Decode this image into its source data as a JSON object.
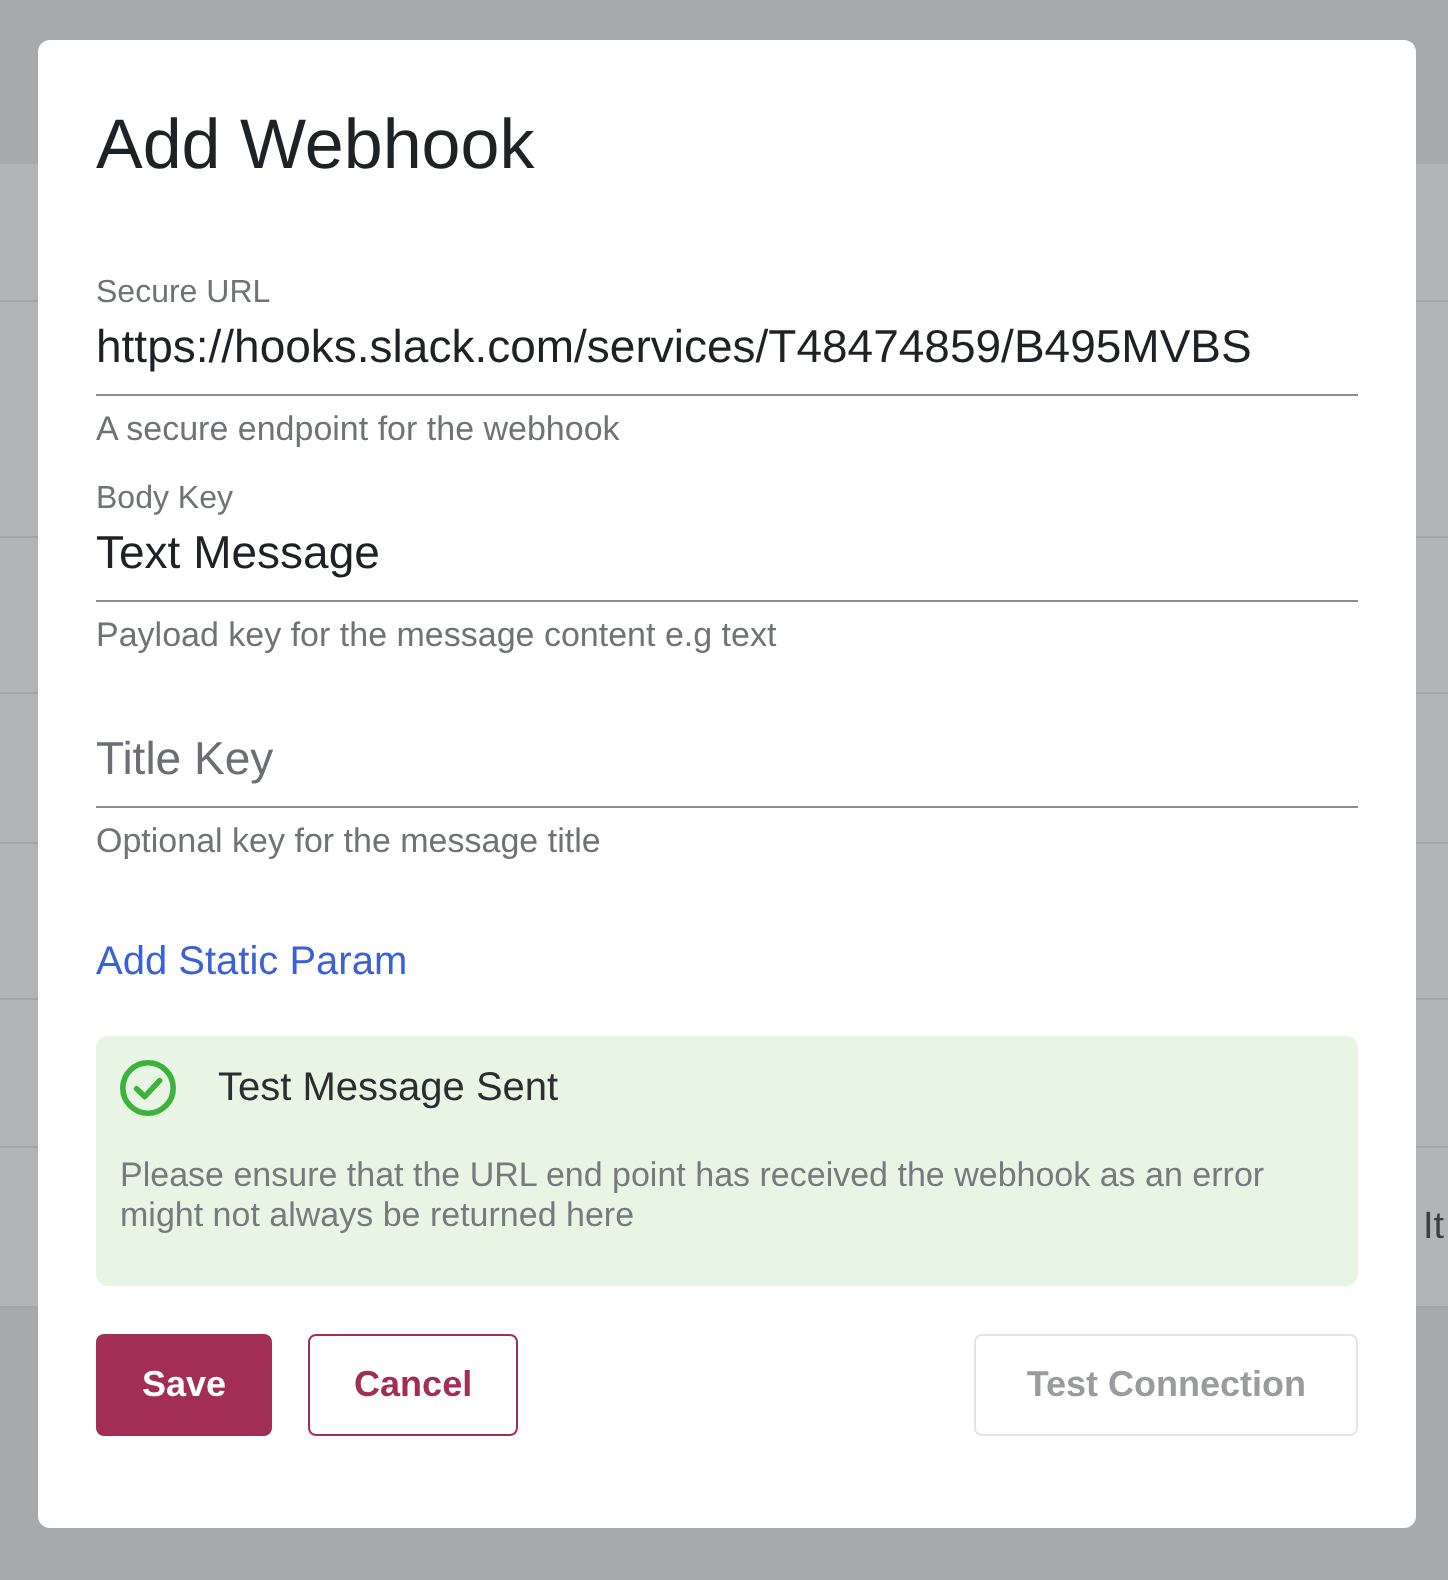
{
  "background": {
    "text": "It"
  },
  "dialog": {
    "title": "Add Webhook",
    "fields": [
      {
        "label": "Secure URL",
        "value": "https://hooks.slack.com/services/T48474859/B495MVBS",
        "helper": "A secure endpoint for the webhook"
      },
      {
        "label": "Body Key",
        "value": "Text Message",
        "helper": "Payload key for the message content e.g text"
      },
      {
        "placeholder": "Title Key",
        "helper": "Optional key for the message title"
      }
    ],
    "link": "Add Static Param",
    "alert": {
      "kind": "success",
      "title": "Test Message Sent",
      "message": "Please ensure that the URL end point has received the webhook as an error might not always be returned here"
    },
    "buttons": [
      {
        "label": "Save",
        "kind": "primary",
        "disabled": false
      },
      {
        "label": "Cancel",
        "kind": "secondary",
        "disabled": false
      },
      {
        "label": "Test Connection",
        "kind": "outline",
        "disabled": true
      }
    ]
  }
}
